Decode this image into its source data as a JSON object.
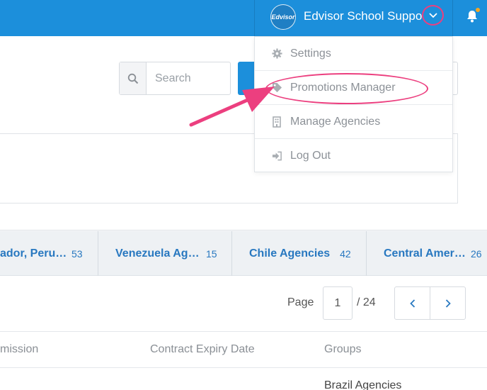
{
  "header": {
    "logo_text": "Edvisor",
    "account_name": "Edvisor School Support",
    "colors": {
      "bar": "#1c8fdb",
      "highlight": "#ec3f7f",
      "notification_dot": "#f5a623"
    },
    "icons": [
      "chevron-down-icon",
      "bell-icon"
    ]
  },
  "dropdown": {
    "items": [
      {
        "label": "Settings",
        "icon": "gear-icon"
      },
      {
        "label": "Promotions Manager",
        "icon": "tag-icon"
      },
      {
        "label": "Manage Agencies",
        "icon": "building-icon"
      },
      {
        "label": "Log Out",
        "icon": "sign-out-icon"
      }
    ]
  },
  "search": {
    "placeholder": "Search",
    "icon": "search-icon"
  },
  "group_tabs": [
    {
      "name": "ador, Peru, ...",
      "count": "53"
    },
    {
      "name": "Venezuela Age...",
      "count": "15"
    },
    {
      "name": "Chile Agencies",
      "count": "42"
    },
    {
      "name": "Central Americ...",
      "count": "26"
    }
  ],
  "pager": {
    "label": "Page",
    "current": "1",
    "total": "/ 24"
  },
  "table": {
    "headers": [
      "mission",
      "Contract Expiry Date",
      "Groups"
    ],
    "first_row_groups": "Brazil Agencies"
  }
}
